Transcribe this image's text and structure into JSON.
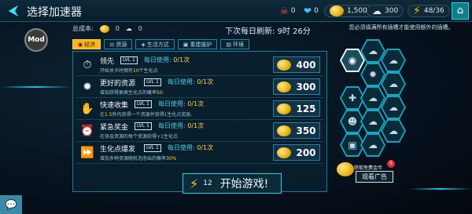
{
  "header": {
    "title": "选择加速器",
    "resources": [
      {
        "icon": "skull-icon",
        "value": "0"
      },
      {
        "icon": "heart-icon",
        "value": "0"
      },
      {
        "icon": "coin-icon",
        "value": "1,500"
      },
      {
        "icon": "silver-cloud-icon",
        "value": "300"
      },
      {
        "icon": "lightning-icon",
        "value": "48/36"
      }
    ]
  },
  "avatar": {
    "label": "Mod"
  },
  "summary": {
    "total_label": "总成本:",
    "coin_cost": "0",
    "cloud_cost": "0",
    "refresh_text": "下次每日刷新: 9时 26分"
  },
  "tabs": [
    {
      "label": "经济",
      "active": true
    },
    {
      "label": "资源"
    },
    {
      "label": "生活方式"
    },
    {
      "label": "重建援护"
    },
    {
      "label": "环境"
    }
  ],
  "boosters": [
    {
      "name": "领先",
      "level": "LVL 1",
      "daily_label": "每日使用:",
      "daily_value": "0/1次",
      "desc_a": "开始关卡时拥有",
      "desc_hl": "10",
      "desc_b": "个生化点",
      "price": "400",
      "icon": "stopwatch-icon"
    },
    {
      "name": "更好的资源",
      "level": "LVL 1",
      "daily_label": "每日使用:",
      "daily_value": "0/1次",
      "desc_a": "增加获得更高生化点的概率",
      "desc_hl": "50",
      "desc_b": ".",
      "price": "300",
      "icon": "virus-icon"
    },
    {
      "name": "快速收集",
      "level": "LVL 1",
      "daily_label": "每日使用:",
      "daily_value": "0/1次",
      "desc_a": "在",
      "desc_hl": "1.5",
      "desc_b": "秒内获得一个资源并获得1生化点奖励.",
      "price": "125",
      "icon": "hand-collect-icon"
    },
    {
      "name": "紧急奖金",
      "level": "LVL 1",
      "daily_label": "每日使用:",
      "daily_value": "0/1次",
      "desc_a": "在协会资源的每个资源获得+1生化点.",
      "desc_hl": "",
      "desc_b": "",
      "price": "350",
      "icon": "alarm-icon"
    },
    {
      "name": "生化点爆发",
      "level": "LVL 1",
      "daily_label": "每日使用:",
      "daily_value": "0/1次",
      "desc_a": "增加多种资源随机泡泡出的概率",
      "desc_hl": "30%",
      "desc_b": "",
      "price": "200",
      "icon": "fast-forward-icon"
    }
  ],
  "start": {
    "energy": "12",
    "label": "开始游戏!"
  },
  "right": {
    "hint": "您必须填满所有插槽才能使用额外的插槽。",
    "ad_title": "获取免费金币",
    "ad_button": "观看广告",
    "ad_badge": "5"
  },
  "colors": {
    "accent": "#19c8f0",
    "active_tab": "#ffb31a",
    "highlight": "#ffd54a"
  }
}
